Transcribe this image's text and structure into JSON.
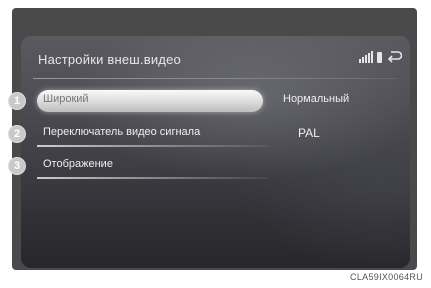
{
  "screen": {
    "title": "Настройки внеш.видео",
    "status_icons": [
      "signal-icon",
      "battery-icon",
      "back-icon"
    ]
  },
  "menu": {
    "items": [
      {
        "callout": "1",
        "label": "Широкий",
        "value": "Нормальный"
      },
      {
        "callout": "2",
        "label": "Переключатель видео сигнала",
        "value": "PAL"
      },
      {
        "callout": "3",
        "label": "Отображение",
        "value": ""
      }
    ]
  },
  "figure": {
    "code": "CLA59IX0064RU"
  }
}
